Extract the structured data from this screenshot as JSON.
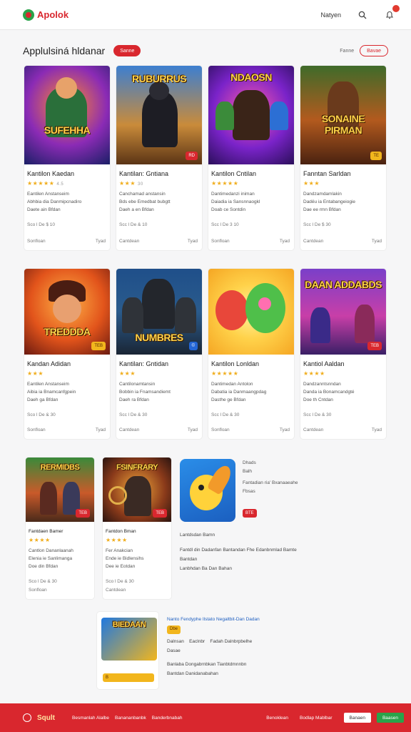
{
  "header": {
    "logo_text": "Apolok",
    "nav_link": "Natyen",
    "search_icon": "search-icon",
    "notification_icon": "bell-icon"
  },
  "section": {
    "title": "Applulsiná hldanar",
    "badge": "Sanne",
    "link": "Fanne",
    "button": "Bavae"
  },
  "row1": [
    {
      "thumb_title": "SUFEHHA",
      "badge": "",
      "name": "Kantilon Kaedan",
      "stars": "★★★★★",
      "rating": "4.5",
      "meta1": "Eantilen Anstanseim",
      "meta2": "Abhbia dia Danmipcnadiro",
      "meta3": "Daete ain Bfdan",
      "price": "Sco l De $ 10",
      "foot_left": "Sonfloan",
      "foot_right": "Tyad"
    },
    {
      "thumb_title": "RUBURRUS",
      "badge": "RD",
      "name": "Kantilan: Gntiana",
      "stars": "★★★",
      "rating": "30",
      "meta1": "Canchamad anstansin",
      "meta2": "Bds ebe Emedbat bubgtt",
      "meta3": "Daeh a en Bfdan",
      "price": "Scc l De & 10",
      "foot_left": "Cantdean",
      "foot_right": "Tyad"
    },
    {
      "thumb_title": "NDAOSN",
      "badge": "",
      "name": "Kantilon Cntilan",
      "stars": "★★★★★",
      "rating": "",
      "meta1": "Dantimedanzi iniman",
      "meta2": "Daiadia ia Sansnnaogkl",
      "meta3": "Doab ce Sontdin",
      "price": "Scc l De 3 10",
      "foot_left": "Sonfloan",
      "foot_right": "Tyad"
    },
    {
      "thumb_title": "SONAINE PIRMAN",
      "badge": "TE",
      "name": "Fanntan Sarldan",
      "stars": "★★★",
      "rating": "",
      "meta1": "Dandzamdamlakin",
      "meta2": "Dadëu ia Entabangeiogie",
      "meta3": "Dae ee rmn Bfdan",
      "price": "Scc l De $ 30",
      "foot_left": "Cantdean",
      "foot_right": "Tyad"
    }
  ],
  "row2": [
    {
      "thumb_title": "TREDDDA",
      "badge": "TEB",
      "name": "Kandan Adidan",
      "stars": "★★★",
      "rating": "",
      "meta1": "Eantilen Anstanseim",
      "meta2": "Aibia ia Bnamcanfgpein",
      "meta3": "Daeh ga Bfdan",
      "price": "Sco l De & 30",
      "foot_left": "Sonfloan",
      "foot_right": "Tyad"
    },
    {
      "thumb_title": "NUMBRES",
      "badge": "©",
      "name": "Kantilan: Gntidan",
      "stars": "★★★",
      "rating": "",
      "meta1": "Cantilonamtansin",
      "meta2": "Bobbin ia Fnamsandiemt",
      "meta3": "Daeh ra Bfdan",
      "price": "Scc l De & 30",
      "foot_left": "Cantdean",
      "foot_right": "Tyad"
    },
    {
      "thumb_title": "",
      "badge": "",
      "name": "Kantilon Lonldan",
      "stars": "★★★★★",
      "rating": "",
      "meta1": "Dantimedan Antolon",
      "meta2": "Dabatia ia Danmaangpdag",
      "meta3": "Dasthe ge Bfdan",
      "price": "Scc l De & 30",
      "foot_left": "Sonfloan",
      "foot_right": "Tyad"
    },
    {
      "thumb_title": "DAAN ADDABDS",
      "badge": "TEB",
      "name": "Kantiol Aaldan",
      "stars": "★★★★",
      "rating": "",
      "meta1": "Dandzanntsnndan",
      "meta2": "Danda ia Bonamcandgté",
      "meta3": "Doe th Cntdan",
      "price": "Scc l De & 30",
      "foot_left": "Cantdean",
      "foot_right": "Tyad"
    }
  ],
  "row3": [
    {
      "thumb_title": "RERMIDBS",
      "badge": "TEB",
      "name": "Fantdaen Bamer",
      "stars": "★★★★",
      "meta1": "Cantlon Dananlaanah",
      "meta2": "Elenia ie Sanlimanga",
      "meta3": "Doe din Bfdan",
      "price": "Sco l De & 30",
      "foot_left": "Sonfloan"
    },
    {
      "thumb_title": "FSINFRARY",
      "badge": "TEB",
      "name": "Fantdon Bman",
      "stars": "★★★★",
      "meta1": "Fer Anakcian",
      "meta2": "Ende ie Bidlensihs",
      "meta3": "Dee ie Eotdan",
      "price": "Sco l De & 30",
      "foot_left": "Cantdean"
    }
  ],
  "featured": {
    "line1": "Dhads",
    "line2": "Balh",
    "line3": "Fantadian ria'  Bxanaaeahe",
    "line4": "Fbsas",
    "badge": "BTE",
    "sub1": "Lantdsdan Bamn",
    "text1": "Fantdl din Dadanfan Bantandan  Fhe   Edanbnmlad Bamte",
    "text2": "Bantdan",
    "text3": "Lanbhdan   Ba Dan Bahan"
  },
  "promo": {
    "thumb_title": "BIEDAAN",
    "title": "Nanto  Fendyphe Ilstato Negaltbit-Dan Dadan",
    "badge": "Dbe",
    "tag1": "Dalnsan",
    "tag2": "Eaclnbr",
    "tag3": "Fadah Dalnbrpbelhe",
    "tag4": "Dasae",
    "line1": "Banlaba Dongabrnbkan Tianbtdmnnbn",
    "line2": "Bantdan Danidanabahan",
    "badge_small": "B"
  },
  "footer": {
    "brand": "Sqult",
    "link1": "Besmanlah Alalbe",
    "link2": "Banananbanbk",
    "link3": "Banderbnabah",
    "link4": "Benoklean",
    "link5": "Bodlap Mablbar",
    "button_white": "Banaen",
    "button_green": "Baasen"
  }
}
